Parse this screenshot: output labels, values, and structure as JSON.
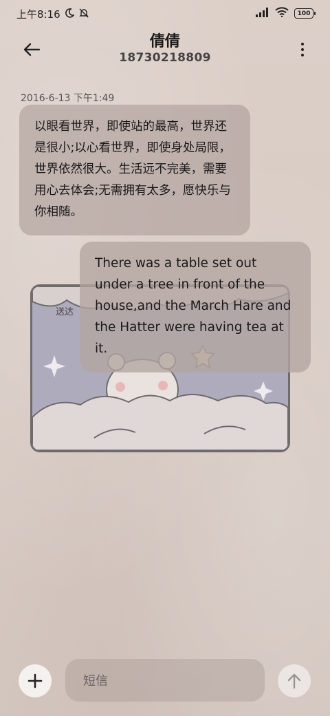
{
  "status_bar": {
    "time": "上午8:16",
    "battery": "100"
  },
  "header": {
    "contact_name": "倩倩",
    "contact_number": "18730218809"
  },
  "conversation": {
    "timestamp": "2016-6-13 下午1:49",
    "incoming_message": "以眼看世界，即使站的最高，世界还是很小;以心看世界，即使身处局限，世界依然很大。生活远不完美，需要用心去体会;无需拥有太多，愿快乐与你相随。",
    "sticker_label": "送达",
    "outgoing_message": "There was a table set out under a tree in front of the house,and the March Hare and the Hatter were having tea at it."
  },
  "composer": {
    "placeholder": "短信"
  },
  "icons": {
    "back": "back-arrow-icon",
    "menu": "more-vertical-icon",
    "add": "plus-icon",
    "send": "send-arrow-up-icon"
  }
}
